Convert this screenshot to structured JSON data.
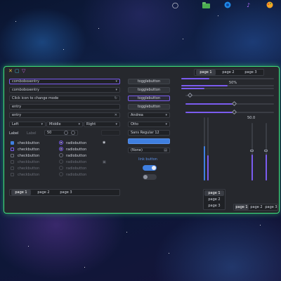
{
  "top_panel": {
    "icons": [
      "power-icon",
      "folder-icon",
      "browser-icon",
      "music-icon",
      "palette-icon"
    ],
    "accent": "#7b5cf0"
  },
  "titlebar": {
    "close": "✕",
    "maximize": "▢",
    "minimize": "▽"
  },
  "left": {
    "combo1": "comboboxentry",
    "combo2": "comboboxentry",
    "icon_entry": "Click icon to change mode",
    "entry1": "entry",
    "entry2": "entry",
    "align_left": "Left",
    "align_middle": "Middle",
    "align_right": "Right",
    "label_text": "Label",
    "label_dim": "Label",
    "spin_value": "50",
    "spin_minus": "−",
    "spin_plus": "+",
    "checkbuttons": [
      "checkbutton",
      "checkbutton",
      "checkbutton",
      "checkbutton",
      "checkbutton",
      "checkbutton"
    ],
    "radiobuttons": [
      "radiobutton",
      "radiobutton",
      "radiobutton",
      "radiobutton",
      "radiobutton",
      "radiobutton"
    ],
    "tabs": [
      "page 1",
      "page 2",
      "page 3"
    ]
  },
  "middle": {
    "togglebuttons": [
      "togglebutton",
      "togglebutton",
      "togglebutton",
      "togglebutton"
    ],
    "combo_andrea": "Andrea",
    "combo_otto": "Otto",
    "font_button": "Sans Regular  12",
    "file_chooser": "(None)",
    "link_button": "link button",
    "switch_on": true,
    "switch_off": false
  },
  "right": {
    "tabs": [
      "page 1",
      "page 2",
      "page 3"
    ],
    "progress_label": "50%",
    "progress_value": 0.5,
    "scale_value": "50.0",
    "vtabs": [
      "page 1",
      "page 2",
      "page 3"
    ],
    "btabs": [
      "page 1",
      "page 2",
      "page 3"
    ]
  }
}
